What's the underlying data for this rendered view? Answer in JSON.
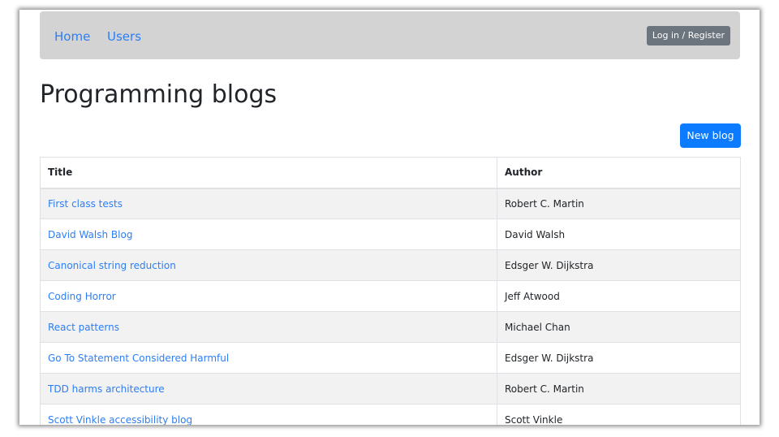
{
  "nav": {
    "home": "Home",
    "users": "Users",
    "login": "Log in / Register"
  },
  "page": {
    "title": "Programming blogs",
    "new_blog": "New blog"
  },
  "table": {
    "headers": {
      "title": "Title",
      "author": "Author"
    },
    "rows": [
      {
        "title": "First class tests",
        "author": "Robert C. Martin"
      },
      {
        "title": "David Walsh Blog",
        "author": "David Walsh"
      },
      {
        "title": "Canonical string reduction",
        "author": "Edsger W. Dijkstra"
      },
      {
        "title": "Coding Horror",
        "author": "Jeff Atwood"
      },
      {
        "title": "React patterns",
        "author": "Michael Chan"
      },
      {
        "title": "Go To Statement Considered Harmful",
        "author": "Edsger W. Dijkstra"
      },
      {
        "title": "TDD harms architecture",
        "author": "Robert C. Martin"
      },
      {
        "title": "Scott Vinkle accessibility blog",
        "author": "Scott Vinkle"
      }
    ]
  },
  "colors": {
    "link": "#2c7ef5",
    "primary": "#0d7bff",
    "secondary": "#6c757d",
    "navbar_bg": "#d3d3d3",
    "stripe": "#f2f2f2"
  }
}
